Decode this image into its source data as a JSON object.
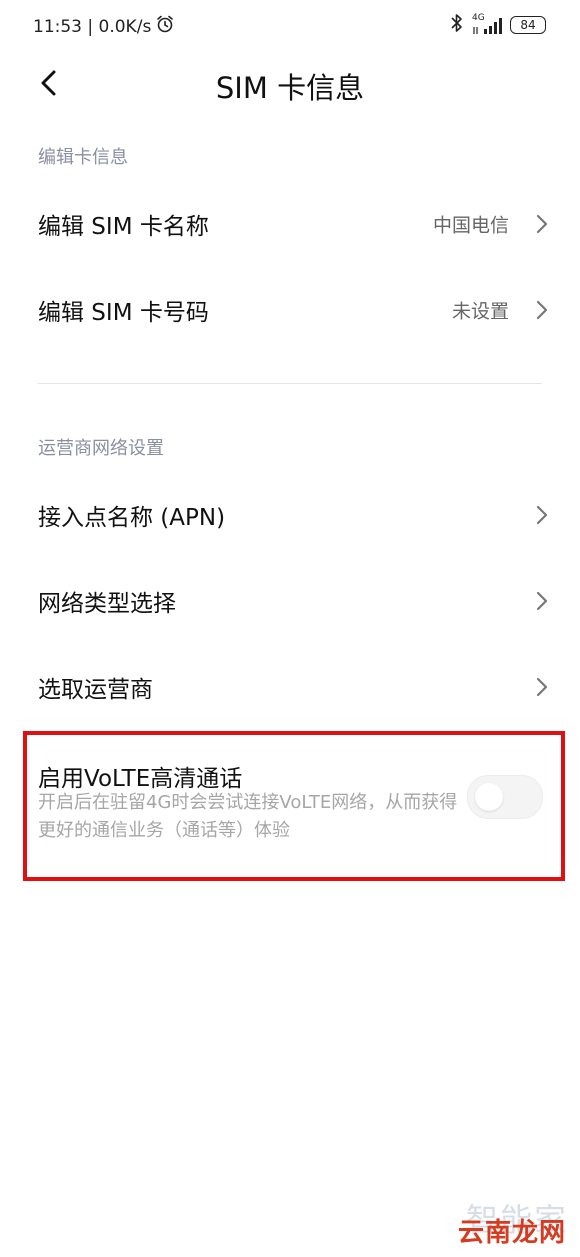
{
  "status_bar": {
    "time_speed": "11:53 | 0.0K/s",
    "network": "4G",
    "battery": "84"
  },
  "header": {
    "title": "SIM 卡信息"
  },
  "sections": {
    "edit": {
      "title": "编辑卡信息",
      "items": [
        {
          "label": "编辑 SIM 卡名称",
          "value": "中国电信"
        },
        {
          "label": "编辑 SIM 卡号码",
          "value": "未设置"
        }
      ]
    },
    "carrier": {
      "title": "运营商网络设置",
      "items": [
        {
          "label": "接入点名称 (APN)"
        },
        {
          "label": "网络类型选择"
        },
        {
          "label": "选取运营商"
        }
      ]
    }
  },
  "volte": {
    "title": "启用VoLTE高清通话",
    "description": "开启后在驻留4G时会尝试连接VoLTE网络，从而获得更好的通信业务（通话等）体验",
    "enabled": false
  },
  "watermark": {
    "top": "智能家",
    "bottom": "云南龙网"
  },
  "colors": {
    "section_title": "#8a8fa3",
    "highlight": "#e01010",
    "watermark_red": "#d43b1f"
  }
}
